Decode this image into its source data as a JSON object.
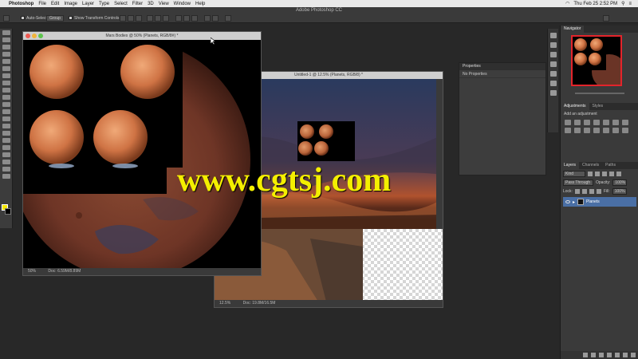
{
  "menubar": {
    "app": "Photoshop",
    "items": [
      "File",
      "Edit",
      "Image",
      "Layer",
      "Type",
      "Select",
      "Filter",
      "3D",
      "View",
      "Window",
      "Help"
    ],
    "clock": "Thu Feb 25  2:52 PM"
  },
  "optbar": {
    "window_title": "Adobe Photoshop CC",
    "auto_select_label": "Auto-Select:",
    "auto_select_value": "Group",
    "transform_label": "Show Transform Controls"
  },
  "doc1": {
    "title": "Mars Bodies @ 50% (Planets, RGB/8#) *",
    "zoom": "50%",
    "info": "Doc: 6.59M/8.89M"
  },
  "doc2": {
    "title": "Untitled-1 @ 12.5% (Planets, RGB/8) *",
    "zoom": "12.5%",
    "info": "Doc: 19.8M/16.5M"
  },
  "properties": {
    "tab": "Properties",
    "sub": "No Properties"
  },
  "navigator": {
    "tab": "Navigator"
  },
  "adjustments": {
    "tabs": [
      "Adjustments",
      "Styles"
    ],
    "sub": "Add an adjustment"
  },
  "layers": {
    "tabs": [
      "Layers",
      "Channels",
      "Paths"
    ],
    "kind": "Kind",
    "blend_mode": "Pass Through",
    "opacity_label": "Opacity:",
    "opacity": "100%",
    "lock_label": "Lock:",
    "fill_label": "Fill:",
    "fill": "100%",
    "layer_name": "Planets"
  },
  "watermark": "www.cgtsj.com",
  "colors": {
    "foreground": "#f5e600",
    "background": "#000000",
    "watermark": "#f4ef00"
  }
}
